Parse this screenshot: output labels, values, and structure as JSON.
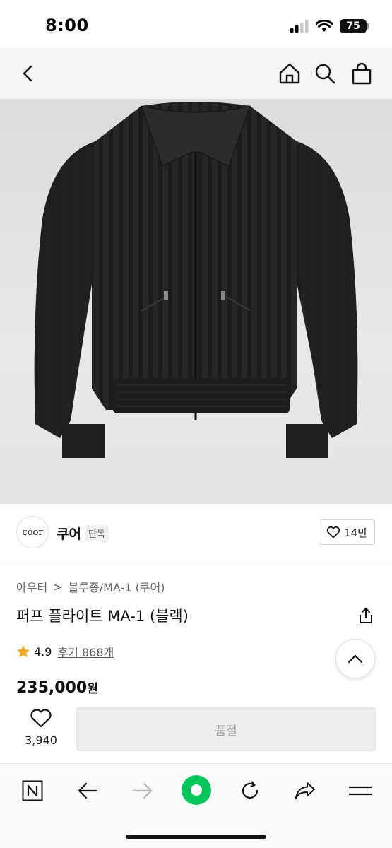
{
  "status_bar": {
    "time": "8:00",
    "battery": "75"
  },
  "nav": {
    "back_icon": "chevron-left-icon",
    "home_icon": "home-icon",
    "search_icon": "search-icon",
    "cart_icon": "shopping-bag-icon"
  },
  "product_image": {
    "description_icon": "black-jacket-image"
  },
  "brand": {
    "logo_text": "coor",
    "name": "쿠어",
    "badge": "단독",
    "likes": "14만"
  },
  "breadcrumb": {
    "category": "아우터",
    "separator": ">",
    "subcategory": "블루종/MA-1 (쿠어)"
  },
  "product": {
    "title": "퍼프 플라이트 MA-1 (블랙)",
    "rating": "4.9",
    "reviews": "후기 868개",
    "price": "235,000",
    "currency": "원"
  },
  "purchase": {
    "wish_count": "3,940",
    "button_label": "품절"
  },
  "browser_toolbar": {
    "n_label": "N"
  },
  "colors": {
    "star": "#f5a623",
    "browser_green": "#03c75a",
    "soldout_bg": "#eeeeee"
  }
}
